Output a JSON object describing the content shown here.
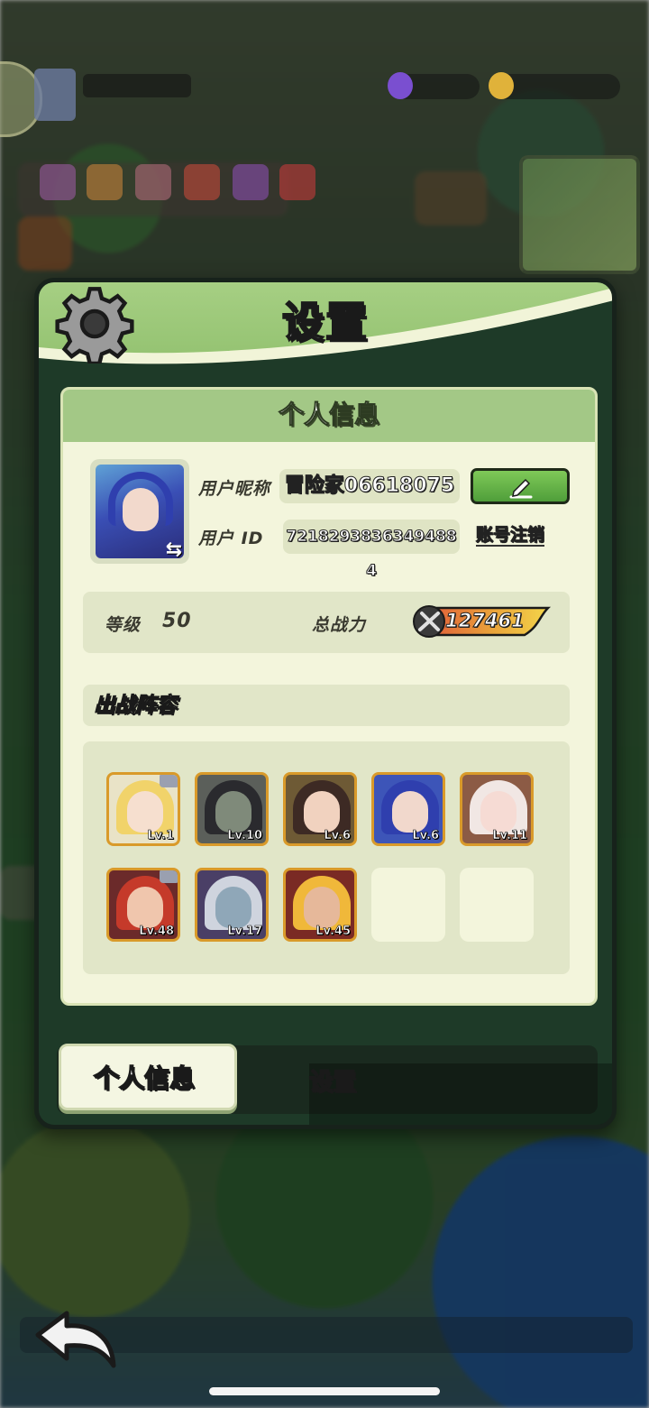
{
  "panel": {
    "title": "设置",
    "section_title": "个人信息"
  },
  "profile": {
    "nickname_label": "用户昵称",
    "nickname_value": "冒险家06618075",
    "id_label": "用户 ID",
    "id_value": "7218293836349488​4",
    "cancel_account_label": "账号注销"
  },
  "stats": {
    "level_label": "等级",
    "level_value": "50",
    "power_label": "总战力",
    "power_value": "127461"
  },
  "lineup": {
    "title": "出战阵容",
    "heroes": [
      {
        "level": "Lv.1",
        "colors": {
          "bg": "#e9e3c7",
          "hair": "#f1d36a",
          "face": "#f6dfcf"
        },
        "badge": true
      },
      {
        "level": "Lv.10",
        "colors": {
          "bg": "#5b5f5a",
          "hair": "#2a2a2e",
          "face": "#7f8a7a"
        },
        "badge": false
      },
      {
        "level": "Lv.6",
        "colors": {
          "bg": "#6e5a35",
          "hair": "#3d2a24",
          "face": "#f1d2bf"
        },
        "badge": false
      },
      {
        "level": "Lv.6",
        "colors": {
          "bg": "#3d55b8",
          "hair": "#2f3fae",
          "face": "#f1d8cc"
        },
        "badge": false
      },
      {
        "level": "Lv.11",
        "colors": {
          "bg": "#8c5b45",
          "hair": "#f1e7e4",
          "face": "#f6dbd4"
        },
        "badge": false
      },
      {
        "level": "Lv.48",
        "colors": {
          "bg": "#6b2a2a",
          "hair": "#c53a2a",
          "face": "#f0c6ad"
        },
        "badge": true
      },
      {
        "level": "Lv.17",
        "colors": {
          "bg": "#4a3f66",
          "hair": "#cfd4de",
          "face": "#8fa7b8"
        },
        "badge": false
      },
      {
        "level": "Lv.45",
        "colors": {
          "bg": "#7a2a24",
          "hair": "#f0b83a",
          "face": "#e6b89a"
        },
        "badge": false
      }
    ]
  },
  "tabs": {
    "active": "个人信息",
    "inactive": "设置"
  },
  "colors": {
    "header_green": "#a6cf83",
    "card_cream": "#f3f5dc",
    "frame_orange": "#d99a2a",
    "edit_green": "#4f9e3a"
  }
}
